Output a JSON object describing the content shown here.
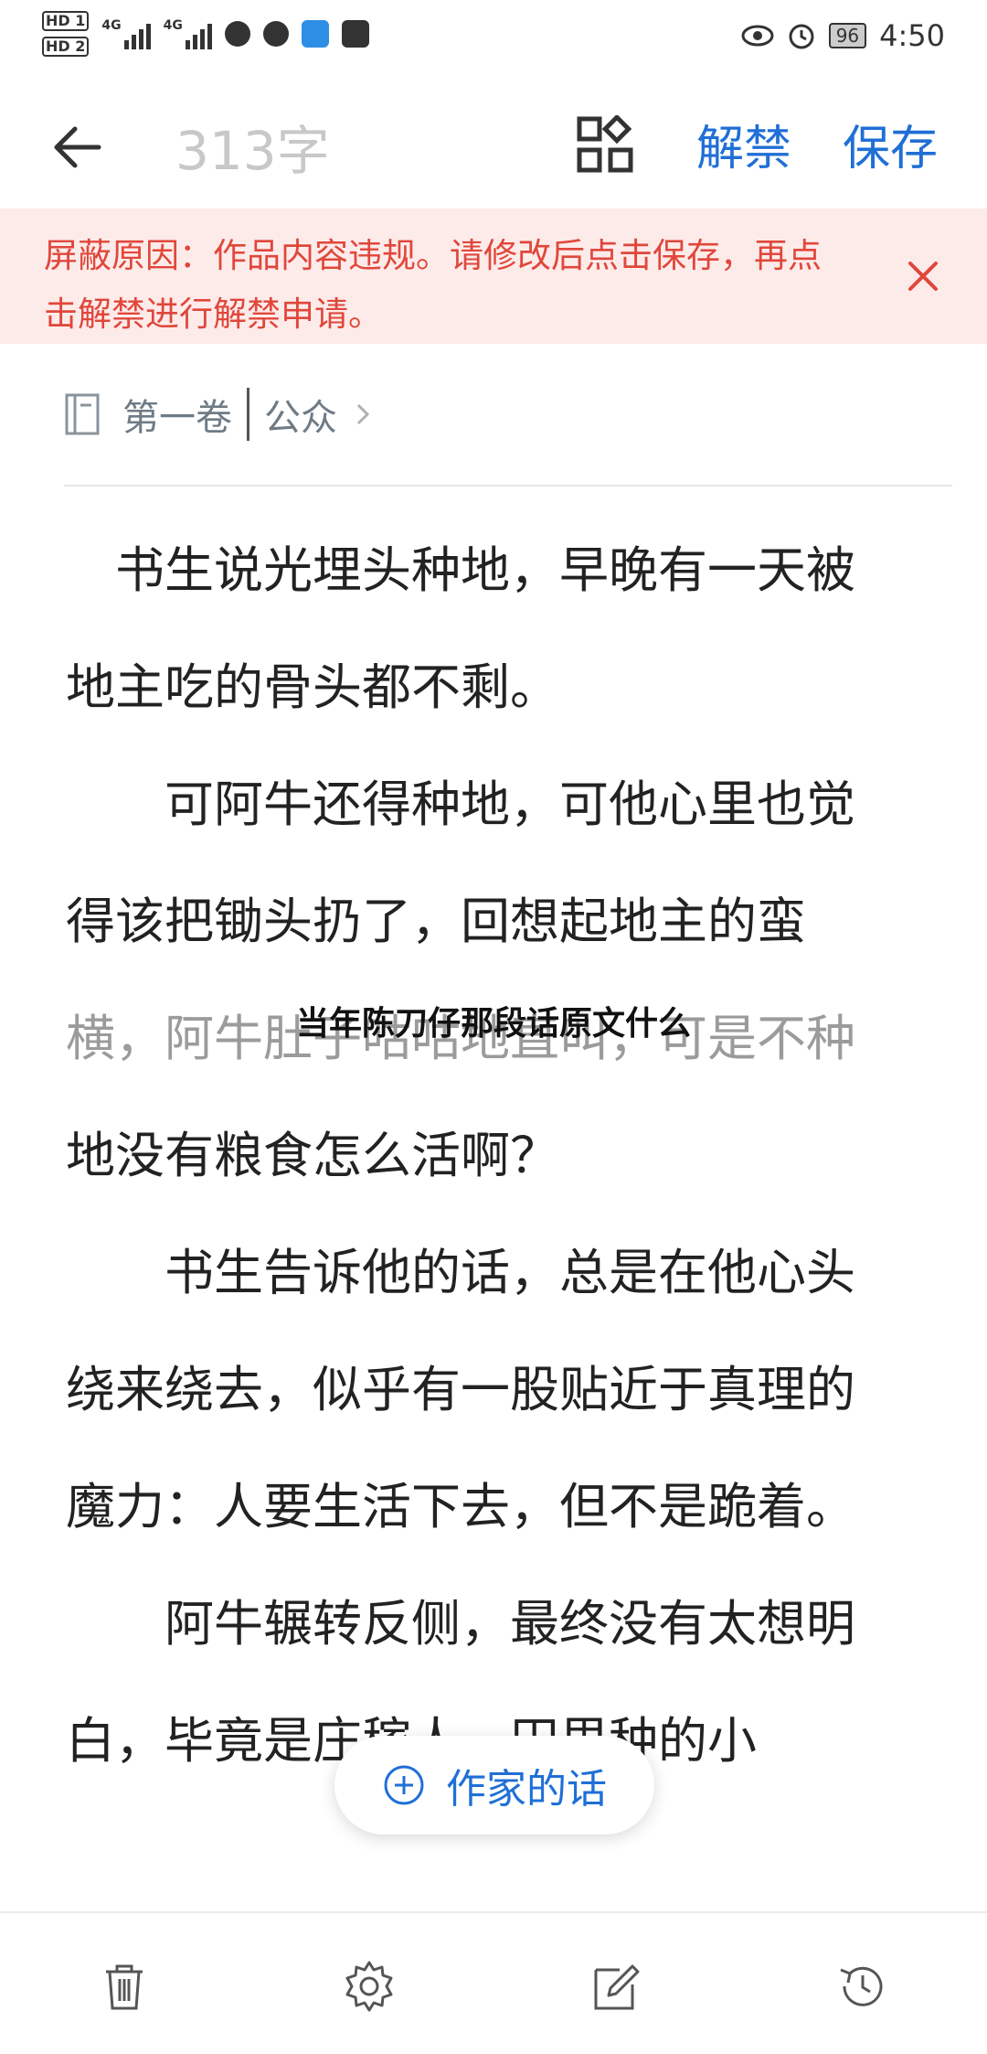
{
  "status_bar": {
    "hd1": "HD 1",
    "hd2": "HD 2",
    "net1": "4G",
    "net2": "4G",
    "battery": "96",
    "time": "4:50"
  },
  "app_bar": {
    "word_count": "313字",
    "unban_label": "解禁",
    "save_label": "保存"
  },
  "banner": {
    "text": "屏蔽原因：作品内容违规。请修改后点击保存，再点击解禁进行解禁申请。"
  },
  "volume": {
    "volume_name": "第一卷",
    "chapter_name": "公众"
  },
  "article": {
    "paragraphs": [
      "书生说光埋头种地，早晚有一天被地主吃的骨头都不剩。",
      "可阿牛还得种地，可他心里也觉得该把锄头扔了，回想起地主的蛮横，阿牛肚子咕咕地直叫，可是不种地没有粮食怎么活啊？",
      "书生告诉他的话，总是在他心头绕来绕去，似乎有一股贴近于真理的魔力：人要生活下去，但不是跪着。",
      "阿牛辗转反侧，最终没有太想明白，毕竟是庄稼人，田里种的小"
    ],
    "overlay_caption": "当年陈刀仔那段话原文什么"
  },
  "author_note_button": {
    "label": "作家的话"
  },
  "icons": {
    "back": "back-arrow-icon",
    "layout": "layout-grid-icon",
    "close": "close-icon",
    "volume": "book-icon",
    "chevron": "chevron-right-icon",
    "plus": "plus-circle-icon",
    "delete": "trash-icon",
    "settings": "gear-icon",
    "edit": "edit-icon",
    "history": "history-icon"
  },
  "colors": {
    "accent": "#1f6fd6",
    "warning_text": "#e0473b",
    "warning_bg": "#fdebea"
  }
}
